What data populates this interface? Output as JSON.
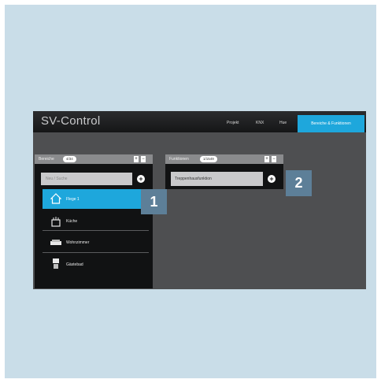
{
  "app": {
    "title": "SV-Control"
  },
  "nav": {
    "items": [
      "Projekt",
      "KNX",
      "Hue"
    ],
    "active": "Bereiche & Funktionen"
  },
  "bereiche": {
    "label": "Bereiche",
    "badge": "4/34",
    "btn_plus": "+",
    "btn_minus": "−",
    "search_placeholder": "Neu / Suche",
    "items": [
      {
        "label": "Flege 1",
        "icon": "house-icon",
        "active": true
      },
      {
        "label": "Küche",
        "icon": "pot-icon",
        "active": false
      },
      {
        "label": "Wohnzimmer",
        "icon": "sofa-icon",
        "active": false
      },
      {
        "label": "Gästebad",
        "icon": "bath-icon",
        "active": false
      }
    ]
  },
  "funktionen": {
    "label": "Funktionen",
    "badge": "1/1549",
    "btn_plus": "+",
    "btn_minus": "−",
    "field_value": "Treppenhausfunktion"
  },
  "callouts": [
    "1",
    "2"
  ],
  "colors": {
    "accent": "#1ea7dc",
    "callout": "#5d7f98",
    "background": "#c9dde8"
  }
}
